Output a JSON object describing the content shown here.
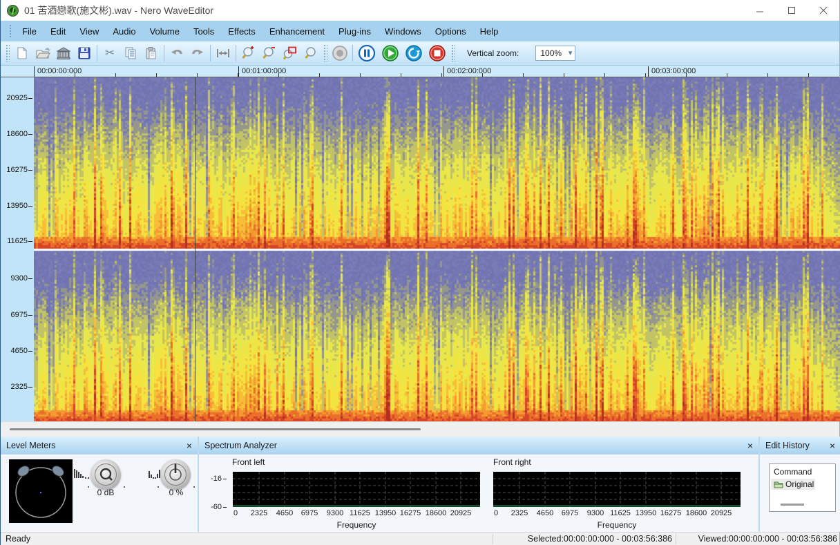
{
  "window": {
    "title": "01 苦酒戀歌(施文彬).wav - Nero WaveEditor"
  },
  "menu": {
    "items": [
      "File",
      "Edit",
      "View",
      "Audio",
      "Volume",
      "Tools",
      "Effects",
      "Enhancement",
      "Plug-ins",
      "Windows",
      "Options",
      "Help"
    ]
  },
  "toolbar": {
    "vertical_zoom_label": "Vertical zoom:",
    "vertical_zoom_value": "100%"
  },
  "icons": {
    "close_glyph": "×",
    "dropdown_chevron": "▾",
    "cut_glyph": "✂"
  },
  "ruler": {
    "ticks": [
      "00:00:00:000",
      "00:01:00:000",
      "00:02:00:000",
      "00:03:00:000"
    ]
  },
  "spectrogram": {
    "freq_labels": [
      "20925",
      "18600",
      "16275",
      "13950",
      "11625",
      "9300",
      "6975",
      "4650",
      "2325"
    ]
  },
  "level_meters": {
    "title": "Level Meters",
    "gain_value": "0 dB",
    "balance_value": "0 %"
  },
  "spectrum_analyzer": {
    "title": "Spectrum Analyzer",
    "left_channel_title": "Front left",
    "right_channel_title": "Front right",
    "y_ticks": [
      "-16",
      "-60"
    ],
    "x_ticks": [
      "0",
      "2325",
      "4650",
      "6975",
      "9300",
      "11625",
      "13950",
      "16275",
      "18600",
      "20925"
    ],
    "x_axis_label": "Frequency"
  },
  "edit_history": {
    "title": "Edit History",
    "column_header": "Command",
    "items": [
      "Original"
    ]
  },
  "status_bar": {
    "ready": "Ready",
    "selected": "Selected:00:00:00:000 - 00:03:56:386",
    "viewed": "Viewed:00:00:00:000 - 00:03:56:386"
  },
  "colors": {
    "menu_blue": "#a6d2f0",
    "spectro_purple": "#7577b4",
    "spectro_yellow": "#ecea4b",
    "spectro_orange": "#f49a31",
    "spectro_red": "#d64428"
  }
}
